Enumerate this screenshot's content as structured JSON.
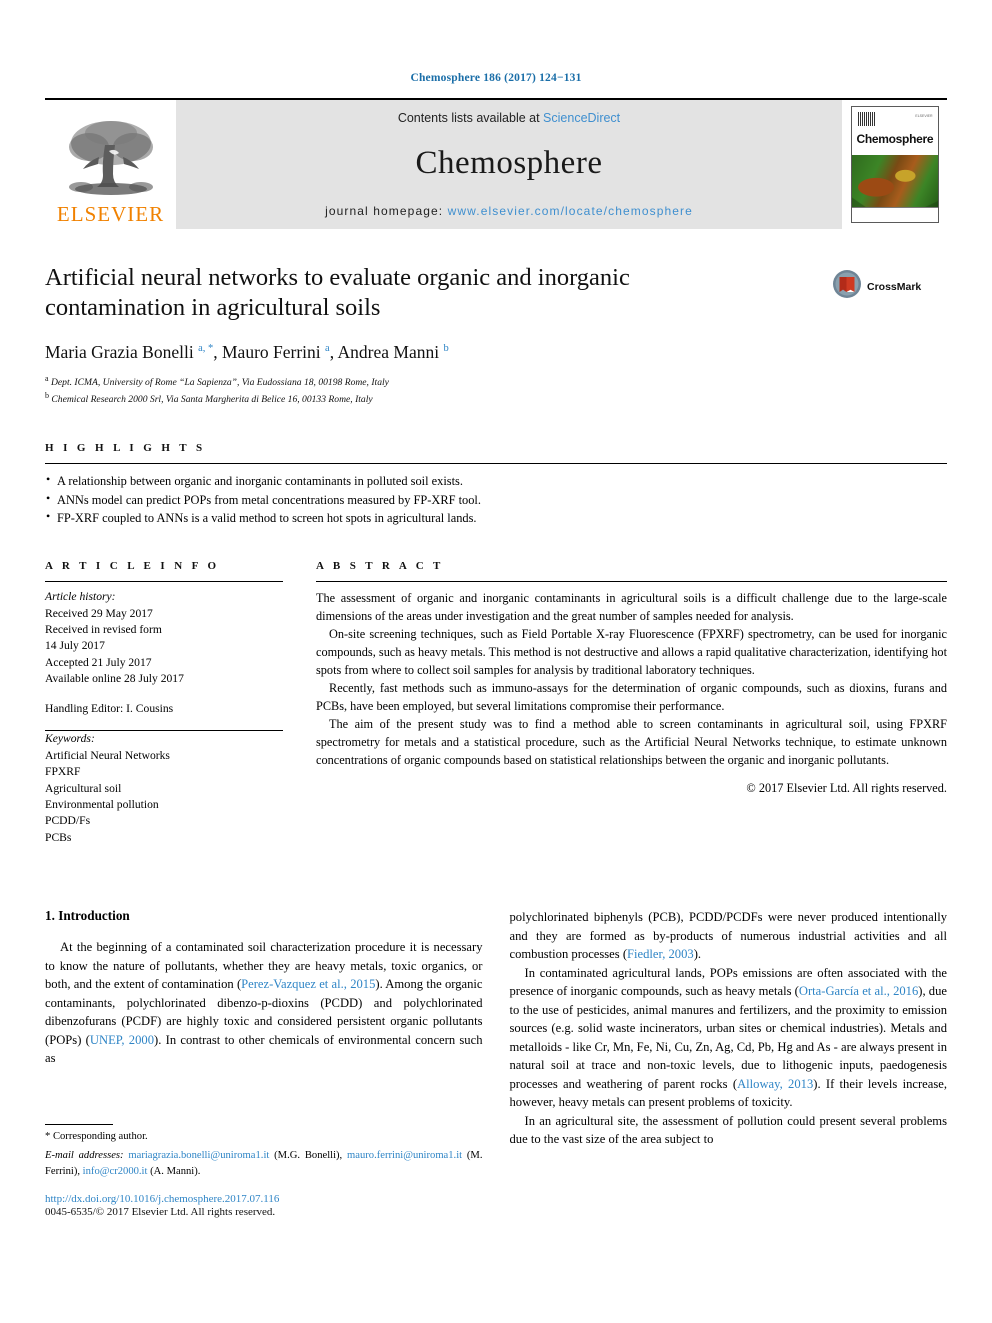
{
  "running_head": "Chemosphere 186 (2017) 124−131",
  "masthead": {
    "publisher": "ELSEVIER",
    "contents_prefix": "Contents lists available at ",
    "contents_link": "ScienceDirect",
    "journal_name": "Chemosphere",
    "homepage_prefix": "journal homepage: ",
    "homepage_url": "www.elsevier.com/locate/chemosphere",
    "cover": {
      "title": "Chemosphere",
      "corner_text": "ELSEVIER"
    }
  },
  "article": {
    "title": "Artificial neural networks to evaluate organic and inorganic contamination in agricultural soils",
    "authors_html": "Maria Grazia Bonelli <sup>a, *</sup>, Mauro Ferrini <sup>a</sup>, Andrea Manni <sup>b</sup>",
    "affiliations": [
      {
        "marker": "a",
        "text": "Dept. ICMA, University of Rome “La Sapienza”, Via Eudossiana 18, 00198 Rome, Italy"
      },
      {
        "marker": "b",
        "text": "Chemical Research 2000 Srl, Via Santa Margherita di Belice 16, 00133 Rome, Italy"
      }
    ],
    "crossmark_label": "CrossMark"
  },
  "highlights": {
    "heading": "H I G H L I G H T S",
    "items": [
      "A relationship between organic and inorganic contaminants in polluted soil exists.",
      "ANNs model can predict POPs from metal concentrations measured by FP-XRF tool.",
      "FP-XRF coupled to ANNs is a valid method to screen hot spots in agricultural lands."
    ]
  },
  "article_info": {
    "heading": "A R T I C L E  I N F O",
    "history_label": "Article history:",
    "history": [
      "Received 29 May 2017",
      "Received in revised form",
      "14 July 2017",
      "Accepted 21 July 2017",
      "Available online 28 July 2017"
    ],
    "handling_editor": "Handling Editor: I. Cousins",
    "keywords_label": "Keywords:",
    "keywords": [
      "Artificial Neural Networks",
      "FPXRF",
      "Agricultural soil",
      "Environmental pollution",
      "PCDD/Fs",
      "PCBs"
    ]
  },
  "abstract": {
    "heading": "A B S T R A C T",
    "paragraphs": [
      "The assessment of organic and inorganic contaminants in agricultural soils is a difficult challenge due to the large-scale dimensions of the areas under investigation and the great number of samples needed for analysis.",
      "On-site screening techniques, such as Field Portable X-ray Fluorescence (FPXRF) spectrometry, can be used for inorganic compounds, such as heavy metals. This method is not destructive and allows a rapid qualitative characterization, identifying hot spots from where to collect soil samples for analysis by traditional laboratory techniques.",
      "Recently, fast methods such as immuno-assays for the determination of organic compounds, such as dioxins, furans and PCBs, have been employed, but several limitations compromise their performance.",
      "The aim of the present study was to find a method able to screen contaminants in agricultural soil, using FPXRF spectrometry for metals and a statistical procedure, such as the Artificial Neural Networks technique, to estimate unknown concentrations of organic compounds based on statistical relationships between the organic and inorganic pollutants."
    ],
    "copyright": "© 2017 Elsevier Ltd. All rights reserved."
  },
  "body": {
    "section_number_title": "1. Introduction",
    "left_paragraph_html": "At the beginning of a contaminated soil characterization procedure it is necessary to know the nature of pollutants, whether they are heavy metals, toxic organics, or both, and the extent of contamination (<span class=\"ref\">Perez-Vazquez et al., 2015</span>). Among the organic contaminants, polychlorinated dibenzo-p-dioxins (PCDD) and polychlorinated dibenzofurans (PCDF) are highly toxic and considered persistent organic pollutants (POPs) (<span class=\"ref\">UNEP, 2000</span>). In contrast to other chemicals of environmental concern such as",
    "right_paragraphs_html": [
      "polychlorinated biphenyls (PCB), PCDD/PCDFs were never produced intentionally and they are formed as by-products of numerous industrial activities and all combustion processes (<span class=\"ref\">Fiedler, 2003</span>).",
      "In contaminated agricultural lands, POPs emissions are often associated with the presence of inorganic compounds, such as heavy metals (<span class=\"ref\">Orta-García et al., 2016</span>), due to the use of pesticides, animal manures and fertilizers, and the proximity to emission sources (e.g. solid waste incinerators, urban sites or chemical industries). Metals and metalloids - like Cr, Mn, Fe, Ni, Cu, Zn, Ag, Cd, Pb, Hg and As - are always present in natural soil at trace and non-toxic levels, due to lithogenic inputs, paedogenesis processes and weathering of parent rocks (<span class=\"ref\">Alloway, 2013</span>). If their levels increase, however, heavy metals can present problems of toxicity.",
      "In an agricultural site, the assessment of pollution could present several problems due to the vast size of the area subject to"
    ]
  },
  "footnotes": {
    "corresponding": "* Corresponding author.",
    "emails_html": "<span class=\"ital\">E-mail addresses:</span> <span class=\"ref\">mariagrazia.bonelli@uniroma1.it</span> (M.G. Bonelli), <span class=\"ref\">mauro.ferrini@uniroma1.it</span> (M. Ferrini), <span class=\"ref\">info@cr2000.it</span> (A. Manni).",
    "doi": "http://dx.doi.org/10.1016/j.chemosphere.2017.07.116",
    "issn": "0045-6535/© 2017 Elsevier Ltd. All rights reserved."
  },
  "colors": {
    "link_blue": "#2f85c6",
    "elsevier_orange": "#f08100",
    "band_gray": "#e3e3e3"
  }
}
